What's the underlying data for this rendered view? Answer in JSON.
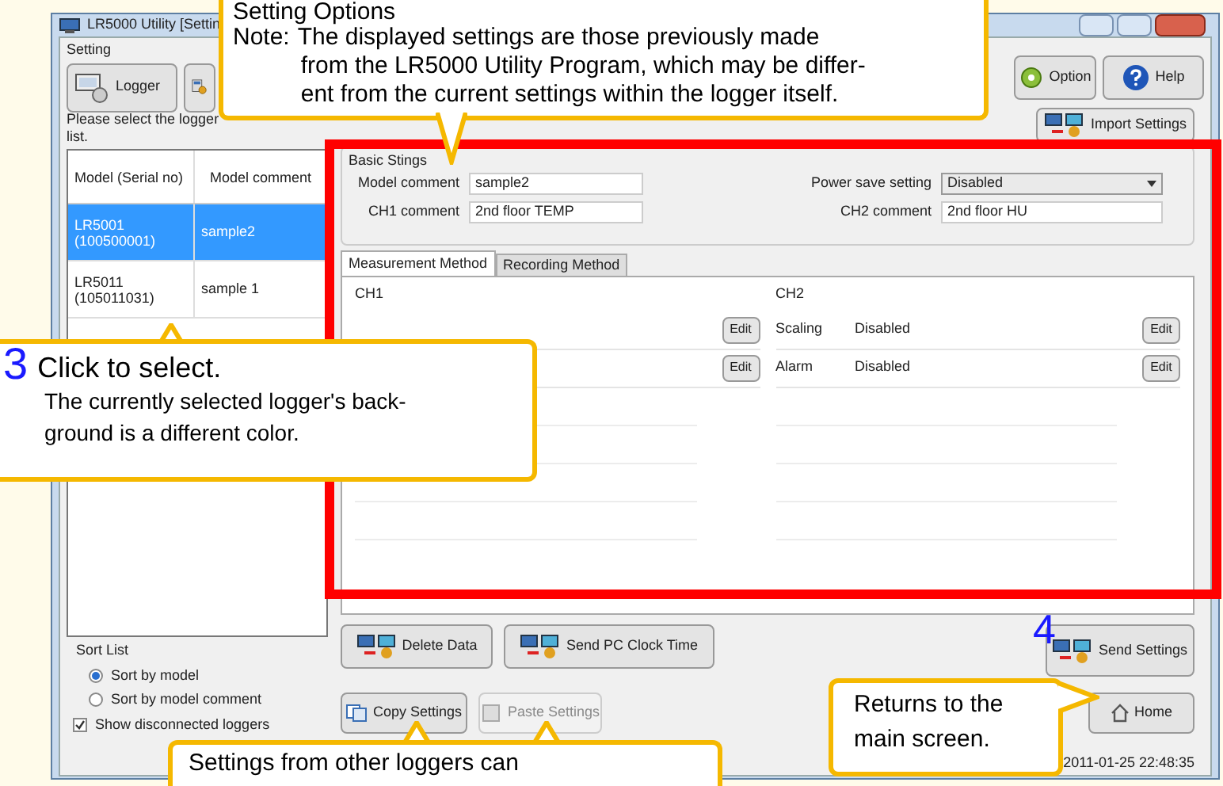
{
  "window": {
    "title": "LR5000 Utility [Settin"
  },
  "toolbar": {
    "group_label": "Setting",
    "left_buttons": [
      {
        "kind": "logger",
        "label": "Logger"
      },
      {
        "kind": "settings"
      }
    ],
    "right_buttons": [
      {
        "kind": "option",
        "label": "Option"
      },
      {
        "kind": "help",
        "label": "Help"
      }
    ]
  },
  "logger_list": {
    "prompt": [
      "Please select the logger",
      "list."
    ],
    "columns": [
      "Model (Serial no)",
      "Model comment"
    ],
    "rows": [
      {
        "model": "LR5001",
        "serial": "(100500001)",
        "comment": "sample2",
        "selected": true
      },
      {
        "model": "LR5011",
        "serial": "(105011031)",
        "comment": "sample 1",
        "selected": false
      }
    ]
  },
  "sort": {
    "label": "Sort List",
    "options": [
      {
        "label": "Sort by model",
        "selected": true
      },
      {
        "label": "Sort by model comment",
        "selected": false
      }
    ],
    "show_disconnected": {
      "label": "Show disconnected loggers",
      "checked": true
    }
  },
  "import_button": "Import Settings",
  "basic_settings": {
    "title": "Basic Stings",
    "model_comment": {
      "label": "Model comment",
      "value": "sample2"
    },
    "ch1_comment": {
      "label": "CH1 comment",
      "value": "2nd floor TEMP"
    },
    "power_save": {
      "label": "Power save setting",
      "value": "Disabled"
    },
    "ch2_comment": {
      "label": "CH2 comment",
      "value": "2nd floor HU"
    }
  },
  "tabs": [
    {
      "label": "Measurement Method",
      "selected": true
    },
    {
      "label": "Recording Method",
      "selected": false
    }
  ],
  "ch1": {
    "title": "CH1",
    "rows": [
      {
        "button": "Edit"
      },
      {
        "button": "Edit"
      }
    ]
  },
  "ch2": {
    "title": "CH2",
    "rows": [
      {
        "name": "Scaling",
        "value": "Disabled",
        "button": "Edit"
      },
      {
        "name": "Alarm",
        "value": "Disabled",
        "button": "Edit"
      }
    ]
  },
  "actions": [
    {
      "kind": "delete",
      "label": "Delete Data",
      "disabled": false
    },
    {
      "kind": "clock",
      "label": "Send PC Clock Time",
      "disabled": false
    },
    {
      "kind": "send",
      "label": "Send Settings",
      "disabled": false
    },
    {
      "kind": "copy",
      "label": "Copy Settings",
      "disabled": false
    },
    {
      "kind": "paste",
      "label": "Paste Settings",
      "disabled": true
    },
    {
      "kind": "home",
      "label": "Home",
      "disabled": false
    }
  ],
  "status_time": "2011-01-25 22:48:35",
  "callouts": {
    "setting_options": {
      "title": "Setting Options",
      "note_label": "Note:",
      "lines": [
        "The displayed settings are those previously made",
        "from the LR5000 Utility Program, which may be differ-",
        "ent from the current settings within the logger itself."
      ]
    },
    "step3": {
      "number": "3",
      "title": "Click to select.",
      "lines": [
        "The currently selected logger's back-",
        "ground is a different color."
      ]
    },
    "step4": {
      "number": "4"
    },
    "home": {
      "lines": [
        "Returns to the",
        "main screen."
      ]
    },
    "copy": {
      "lines": [
        "Settings from other loggers can"
      ]
    }
  }
}
